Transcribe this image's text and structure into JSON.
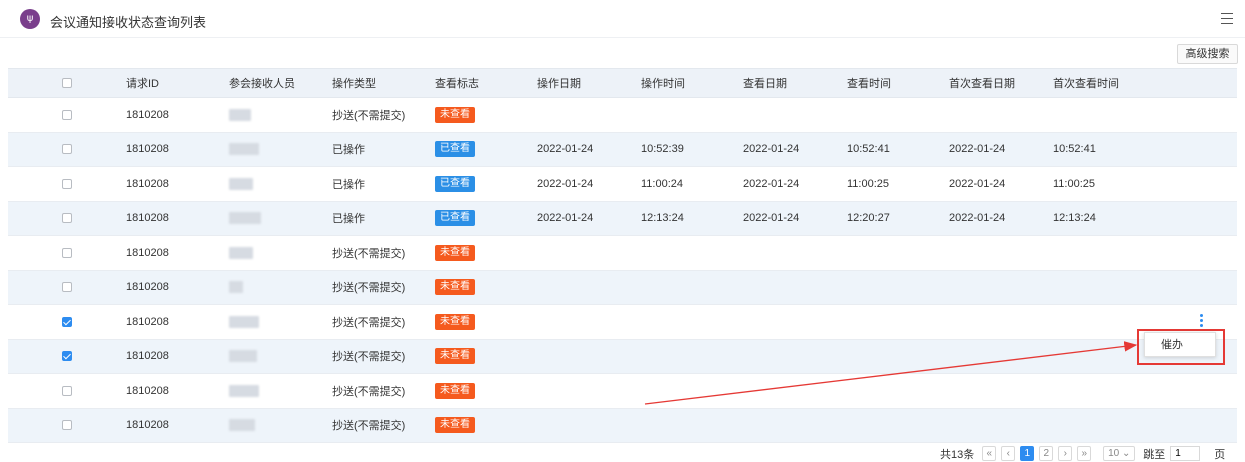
{
  "header": {
    "title": "会议通知接收状态查询列表",
    "logo_icon": "purple-circle-logo",
    "menu_icon": "list-menu-icon"
  },
  "toolbar": {
    "advanced_search": "高级搜索"
  },
  "table": {
    "columns": [
      "请求ID",
      "参会接收人员",
      "操作类型",
      "查看标志",
      "操作日期",
      "操作时间",
      "查看日期",
      "查看时间",
      "首次查看日期",
      "首次查看时间"
    ],
    "rows": [
      {
        "checked": false,
        "id": "1810208",
        "op_type": "抄送(不需提交)",
        "flag": "未查看",
        "op_date": "",
        "op_time": "",
        "view_date": "",
        "view_time": "",
        "first_date": "",
        "first_time": ""
      },
      {
        "checked": false,
        "id": "1810208",
        "op_type": "已操作",
        "flag": "已查看",
        "op_date": "2022-01-24",
        "op_time": "10:52:39",
        "view_date": "2022-01-24",
        "view_time": "10:52:41",
        "first_date": "2022-01-24",
        "first_time": "10:52:41"
      },
      {
        "checked": false,
        "id": "1810208",
        "op_type": "已操作",
        "flag": "已查看",
        "op_date": "2022-01-24",
        "op_time": "11:00:24",
        "view_date": "2022-01-24",
        "view_time": "11:00:25",
        "first_date": "2022-01-24",
        "first_time": "11:00:25"
      },
      {
        "checked": false,
        "id": "1810208",
        "op_type": "已操作",
        "flag": "已查看",
        "op_date": "2022-01-24",
        "op_time": "12:13:24",
        "view_date": "2022-01-24",
        "view_time": "12:20:27",
        "first_date": "2022-01-24",
        "first_time": "12:13:24"
      },
      {
        "checked": false,
        "id": "1810208",
        "op_type": "抄送(不需提交)",
        "flag": "未查看",
        "op_date": "",
        "op_time": "",
        "view_date": "",
        "view_time": "",
        "first_date": "",
        "first_time": ""
      },
      {
        "checked": false,
        "id": "1810208",
        "op_type": "抄送(不需提交)",
        "flag": "未查看",
        "op_date": "",
        "op_time": "",
        "view_date": "",
        "view_time": "",
        "first_date": "",
        "first_time": ""
      },
      {
        "checked": true,
        "id": "1810208",
        "op_type": "抄送(不需提交)",
        "flag": "未查看",
        "op_date": "",
        "op_time": "",
        "view_date": "",
        "view_time": "",
        "first_date": "",
        "first_time": ""
      },
      {
        "checked": true,
        "id": "1810208",
        "op_type": "抄送(不需提交)",
        "flag": "未查看",
        "op_date": "",
        "op_time": "",
        "view_date": "",
        "view_time": "",
        "first_date": "",
        "first_time": ""
      },
      {
        "checked": false,
        "id": "1810208",
        "op_type": "抄送(不需提交)",
        "flag": "未查看",
        "op_date": "",
        "op_time": "",
        "view_date": "",
        "view_time": "",
        "first_date": "",
        "first_time": ""
      },
      {
        "checked": false,
        "id": "1810208",
        "op_type": "抄送(不需提交)",
        "flag": "未查看",
        "op_date": "",
        "op_time": "",
        "view_date": "",
        "view_time": "",
        "first_date": "",
        "first_time": ""
      }
    ]
  },
  "context_menu": {
    "item": "催办"
  },
  "pagination": {
    "total": "共13条",
    "first": "«",
    "prev": "‹",
    "pages": [
      "1",
      "2"
    ],
    "current": "1",
    "next": "›",
    "last": "»",
    "page_size": "10",
    "jump_label": "跳至",
    "jump_value": "1",
    "page_suffix": "页"
  },
  "colors": {
    "accent": "#2d8cf0",
    "unread_badge": "#f55a1e",
    "read_badge": "#2b8fe6",
    "highlight": "#e53935",
    "logo": "#7a3e8c"
  }
}
